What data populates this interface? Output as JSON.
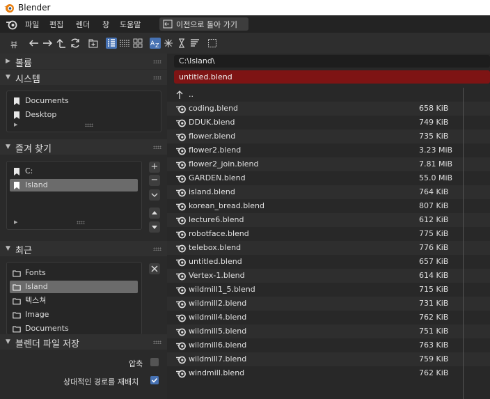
{
  "window": {
    "title": "Blender"
  },
  "menu": {
    "items": [
      "파일",
      "편집",
      "렌더",
      "창",
      "도움말"
    ],
    "back_label": "이전으로 돌아 가기"
  },
  "toolbar": {
    "view_label": "뷰"
  },
  "panels": {
    "volumes": "볼륨",
    "system": "시스템",
    "favorites": "즐겨 찾기",
    "recent": "최근",
    "save_options": "블렌더 파일 저장"
  },
  "system_items": [
    "Documents",
    "Desktop"
  ],
  "favorite_items": [
    "C:",
    "Island"
  ],
  "recent_items": [
    "Fonts",
    "Island",
    "텍스쳐",
    "Image",
    "Documents"
  ],
  "options": {
    "compress_label": "압축",
    "compress_checked": false,
    "remap_label": "상대적인 경로를 재배치",
    "remap_checked": true
  },
  "path": "C:\\Island\\",
  "filename": "untitled.blend",
  "parent_label": "..",
  "files": [
    {
      "name": "coding.blend",
      "size": "658 KiB"
    },
    {
      "name": "DDUK.blend",
      "size": "749 KiB"
    },
    {
      "name": "flower.blend",
      "size": "735 KiB"
    },
    {
      "name": "flower2.blend",
      "size": "3.23 MiB"
    },
    {
      "name": "flower2_join.blend",
      "size": "7.81 MiB"
    },
    {
      "name": "GARDEN.blend",
      "size": "55.0 MiB"
    },
    {
      "name": "island.blend",
      "size": "764 KiB"
    },
    {
      "name": "korean_bread.blend",
      "size": "807 KiB"
    },
    {
      "name": "lecture6.blend",
      "size": "612 KiB"
    },
    {
      "name": "robotface.blend",
      "size": "775 KiB"
    },
    {
      "name": "telebox.blend",
      "size": "776 KiB"
    },
    {
      "name": "untitled.blend",
      "size": "657 KiB"
    },
    {
      "name": "Vertex-1.blend",
      "size": "614 KiB"
    },
    {
      "name": "wildmill1_5.blend",
      "size": "715 KiB"
    },
    {
      "name": "wildmill2.blend",
      "size": "731 KiB"
    },
    {
      "name": "wildmill4.blend",
      "size": "762 KiB"
    },
    {
      "name": "wildmill5.blend",
      "size": "751 KiB"
    },
    {
      "name": "wildmill6.blend",
      "size": "763 KiB"
    },
    {
      "name": "wildmill7.blend",
      "size": "759 KiB"
    },
    {
      "name": "windmill.blend",
      "size": "762 KiB"
    }
  ],
  "colors": {
    "accent": "#4772b3",
    "filename_bg": "#7e1414",
    "selected": "#6b6b6b"
  }
}
